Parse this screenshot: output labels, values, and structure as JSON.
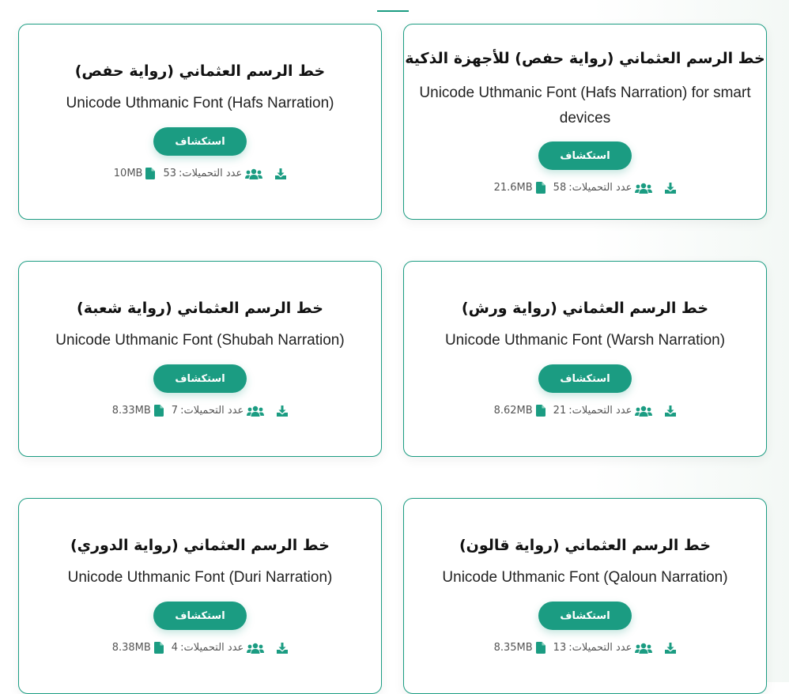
{
  "accent_color": "#1b9c82",
  "cards": [
    {
      "title": "خط الرسم العثماني (رواية حفص) للأجهزة الذكية",
      "subtitle": "Unicode Uthmanic Font (Hafs Narration) for smart devices",
      "button_label": "استكشاف",
      "downloads_label": "عدد التحميلات:",
      "downloads_count": "58",
      "file_size": "21.6MB"
    },
    {
      "title": "خط الرسم العثماني (رواية حفص)",
      "subtitle": "Unicode Uthmanic Font (Hafs Narration)",
      "button_label": "استكشاف",
      "downloads_label": "عدد التحميلات:",
      "downloads_count": "53",
      "file_size": "10MB"
    },
    {
      "title": "خط الرسم العثماني (رواية ورش)",
      "subtitle": "Unicode Uthmanic Font (Warsh Narration)",
      "button_label": "استكشاف",
      "downloads_label": "عدد التحميلات:",
      "downloads_count": "21",
      "file_size": "8.62MB"
    },
    {
      "title": "خط الرسم العثماني (رواية شعبة)",
      "subtitle": "Unicode Uthmanic Font (Shubah Narration)",
      "button_label": "استكشاف",
      "downloads_label": "عدد التحميلات:",
      "downloads_count": "7",
      "file_size": "8.33MB"
    },
    {
      "title": "خط الرسم العثماني (رواية قالون)",
      "subtitle": "Unicode Uthmanic Font (Qaloun Narration)",
      "button_label": "استكشاف",
      "downloads_label": "عدد التحميلات:",
      "downloads_count": "13",
      "file_size": "8.35MB"
    },
    {
      "title": "خط الرسم العثماني (رواية الدوري)",
      "subtitle": "Unicode Uthmanic Font (Duri Narration)",
      "button_label": "استكشاف",
      "downloads_label": "عدد التحميلات:",
      "downloads_count": "4",
      "file_size": "8.38MB"
    }
  ],
  "icons": {
    "download": "download-icon",
    "users": "users-icon",
    "file": "file-icon"
  }
}
